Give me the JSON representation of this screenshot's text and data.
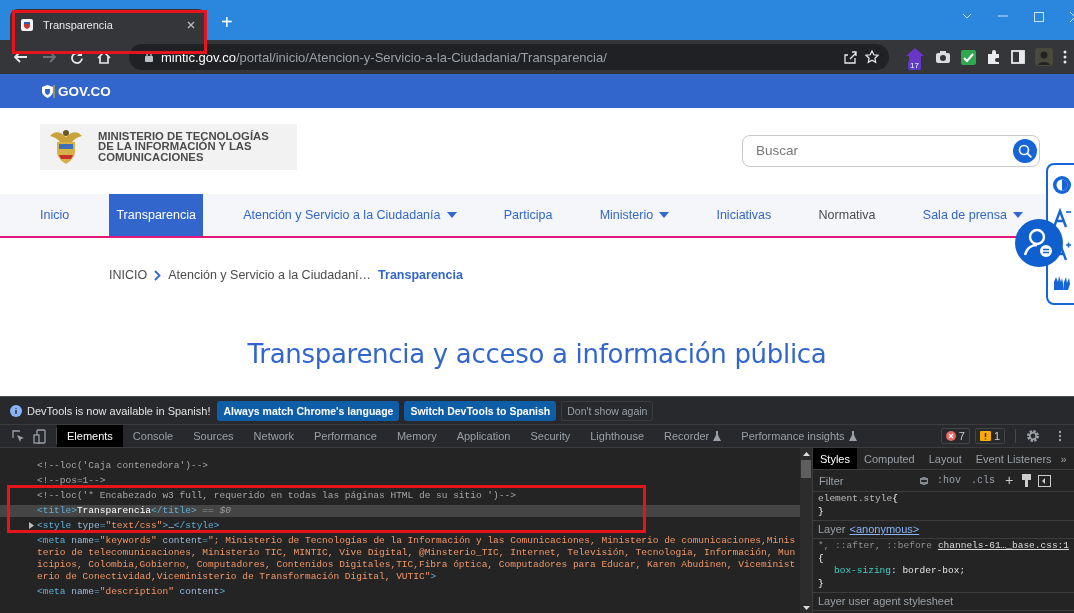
{
  "browser": {
    "tab": {
      "title": "Transparencia"
    },
    "new_tab": "+",
    "address": {
      "domain": "mintic.gov.co",
      "path": "/portal/inicio/Atencion-y-Servicio-a-la-Ciudadania/Transparencia/"
    },
    "extension_badge": "17"
  },
  "gov_bar": {
    "logo": "GOV.CO"
  },
  "header": {
    "ministry": "MINISTERIO DE TECNOLOGÍAS DE LA INFORMACIÓN Y LAS COMUNICACIONES",
    "search": {
      "placeholder": "Buscar"
    }
  },
  "nav": [
    {
      "label": "Inicio",
      "selected": false,
      "dropdown": false,
      "visited": false
    },
    {
      "label": "Transparencia",
      "selected": true,
      "dropdown": false,
      "visited": false
    },
    {
      "label": "Atención y Servicio a la Ciudadanía",
      "selected": false,
      "dropdown": true,
      "visited": false
    },
    {
      "label": "Participa",
      "selected": false,
      "dropdown": false,
      "visited": false
    },
    {
      "label": "Ministerio",
      "selected": false,
      "dropdown": true,
      "visited": false
    },
    {
      "label": "Iniciativas",
      "selected": false,
      "dropdown": false,
      "visited": false
    },
    {
      "label": "Normativa",
      "selected": false,
      "dropdown": false,
      "visited": true
    },
    {
      "label": "Sala de prensa",
      "selected": false,
      "dropdown": true,
      "visited": false
    }
  ],
  "breadcrumb": [
    {
      "label": "INICIO",
      "current": false,
      "separator": true
    },
    {
      "label": "Atención y Servicio a la Ciudadaní…",
      "current": false,
      "separator": false
    },
    {
      "label": "Transparencia",
      "current": true,
      "separator": false
    }
  ],
  "page_title": "Transparencia y acceso a información pública",
  "devtools": {
    "infobar": {
      "message": "DevTools is now available in Spanish!",
      "buttons": [
        {
          "label": "Always match Chrome's language",
          "kind": "primary"
        },
        {
          "label": "Switch DevTools to Spanish",
          "kind": "primary"
        },
        {
          "label": "Don't show again",
          "kind": "secondary"
        }
      ]
    },
    "tabs": [
      {
        "label": "Elements",
        "selected": true,
        "experimental": false
      },
      {
        "label": "Console",
        "selected": false,
        "experimental": false
      },
      {
        "label": "Sources",
        "selected": false,
        "experimental": false
      },
      {
        "label": "Network",
        "selected": false,
        "experimental": false
      },
      {
        "label": "Performance",
        "selected": false,
        "experimental": false
      },
      {
        "label": "Memory",
        "selected": false,
        "experimental": false
      },
      {
        "label": "Application",
        "selected": false,
        "experimental": false
      },
      {
        "label": "Security",
        "selected": false,
        "experimental": false
      },
      {
        "label": "Lighthouse",
        "selected": false,
        "experimental": false
      },
      {
        "label": "Recorder",
        "selected": false,
        "experimental": true
      },
      {
        "label": "Performance insights",
        "selected": false,
        "experimental": true
      }
    ],
    "error_count": "7",
    "warning_count": "1",
    "dom_lines": [
      {
        "selected": false,
        "expandable": false,
        "segments": [
          {
            "kind": "comment",
            "text": "<!--loc('Caja contenedora')-->"
          }
        ]
      },
      {
        "selected": false,
        "expandable": false,
        "segments": [
          {
            "kind": "comment",
            "text": "<!--pos=1-->"
          }
        ]
      },
      {
        "selected": false,
        "expandable": false,
        "segments": [
          {
            "kind": "comment",
            "text": "<!--loc('* Encabezado w3 full, requerido en todas las páginas HTML de su sitio ')-->"
          }
        ]
      },
      {
        "selected": true,
        "expandable": false,
        "segments": [
          {
            "kind": "tag",
            "text": "<title>"
          },
          {
            "kind": "text",
            "text": "Transparencia"
          },
          {
            "kind": "tag",
            "text": "</title>"
          },
          {
            "kind": "marker",
            "text": " == $0"
          }
        ]
      },
      {
        "selected": false,
        "expandable": true,
        "segments": [
          {
            "kind": "tag",
            "text": "<style "
          },
          {
            "kind": "attr",
            "text": "type"
          },
          {
            "kind": "tag",
            "text": "="
          },
          {
            "kind": "value",
            "text": "\"text/css\""
          },
          {
            "kind": "tag",
            "text": ">"
          },
          {
            "kind": "text",
            "text": "…"
          },
          {
            "kind": "tag",
            "text": "</style>"
          }
        ]
      },
      {
        "selected": false,
        "expandable": false,
        "segments": [
          {
            "kind": "tag",
            "text": "<meta "
          },
          {
            "kind": "attr",
            "text": "name"
          },
          {
            "kind": "tag",
            "text": "="
          },
          {
            "kind": "value",
            "text": "\"keywords\""
          },
          {
            "kind": "attr",
            "text": " content"
          },
          {
            "kind": "tag",
            "text": "="
          },
          {
            "kind": "value",
            "text": "\"; Ministerio de Tecnologías de la Información y las Comunicaciones, Ministerio de comunicaciones,Ministerio de telecomunicaciones, Ministerio TIC, MINTIC, Vive Digital, @Minsterio_TIC, Internet, Televisión, Tecnología, Información, Municipios, Colombia,Gobierno, Computadores, Contenidos Digitales,TIC,Fibra óptica, Computadores para Educar, Karen Abudinen, Viceministerio de Conectividad,Viceministerio de Transformación Digital, VUTIC\""
          },
          {
            "kind": "tag",
            "text": ">"
          }
        ]
      },
      {
        "selected": false,
        "expandable": false,
        "segments": [
          {
            "kind": "tag",
            "text": "<meta "
          },
          {
            "kind": "attr",
            "text": "name"
          },
          {
            "kind": "tag",
            "text": "="
          },
          {
            "kind": "value",
            "text": "\"description\""
          },
          {
            "kind": "attr",
            "text": " content"
          },
          {
            "kind": "tag",
            "text": ">"
          }
        ]
      }
    ],
    "styles": {
      "tabs": [
        {
          "label": "Styles",
          "selected": true
        },
        {
          "label": "Computed",
          "selected": false
        },
        {
          "label": "Layout",
          "selected": false
        },
        {
          "label": "Event Listeners",
          "selected": false
        }
      ],
      "overflow": "»",
      "filter": {
        "placeholder": "Filter"
      },
      "toggles": [
        ":hov",
        ".cls"
      ],
      "new_rule": "+",
      "sections": [
        {
          "kind": "rule",
          "selector": "element.style",
          "open": "{",
          "close": "}"
        },
        {
          "kind": "layer",
          "label": "Layer",
          "link": "<anonymous>"
        },
        {
          "kind": "rule",
          "selector": "*, ::after, ::before",
          "source": "channels-61…_base.css:1",
          "open": "{",
          "close": "}",
          "declarations": [
            {
              "property": "box-sizing",
              "separator": ":",
              "value": "border-box;"
            }
          ]
        },
        {
          "kind": "layer",
          "label": "Layer user agent stylesheet"
        }
      ]
    }
  }
}
